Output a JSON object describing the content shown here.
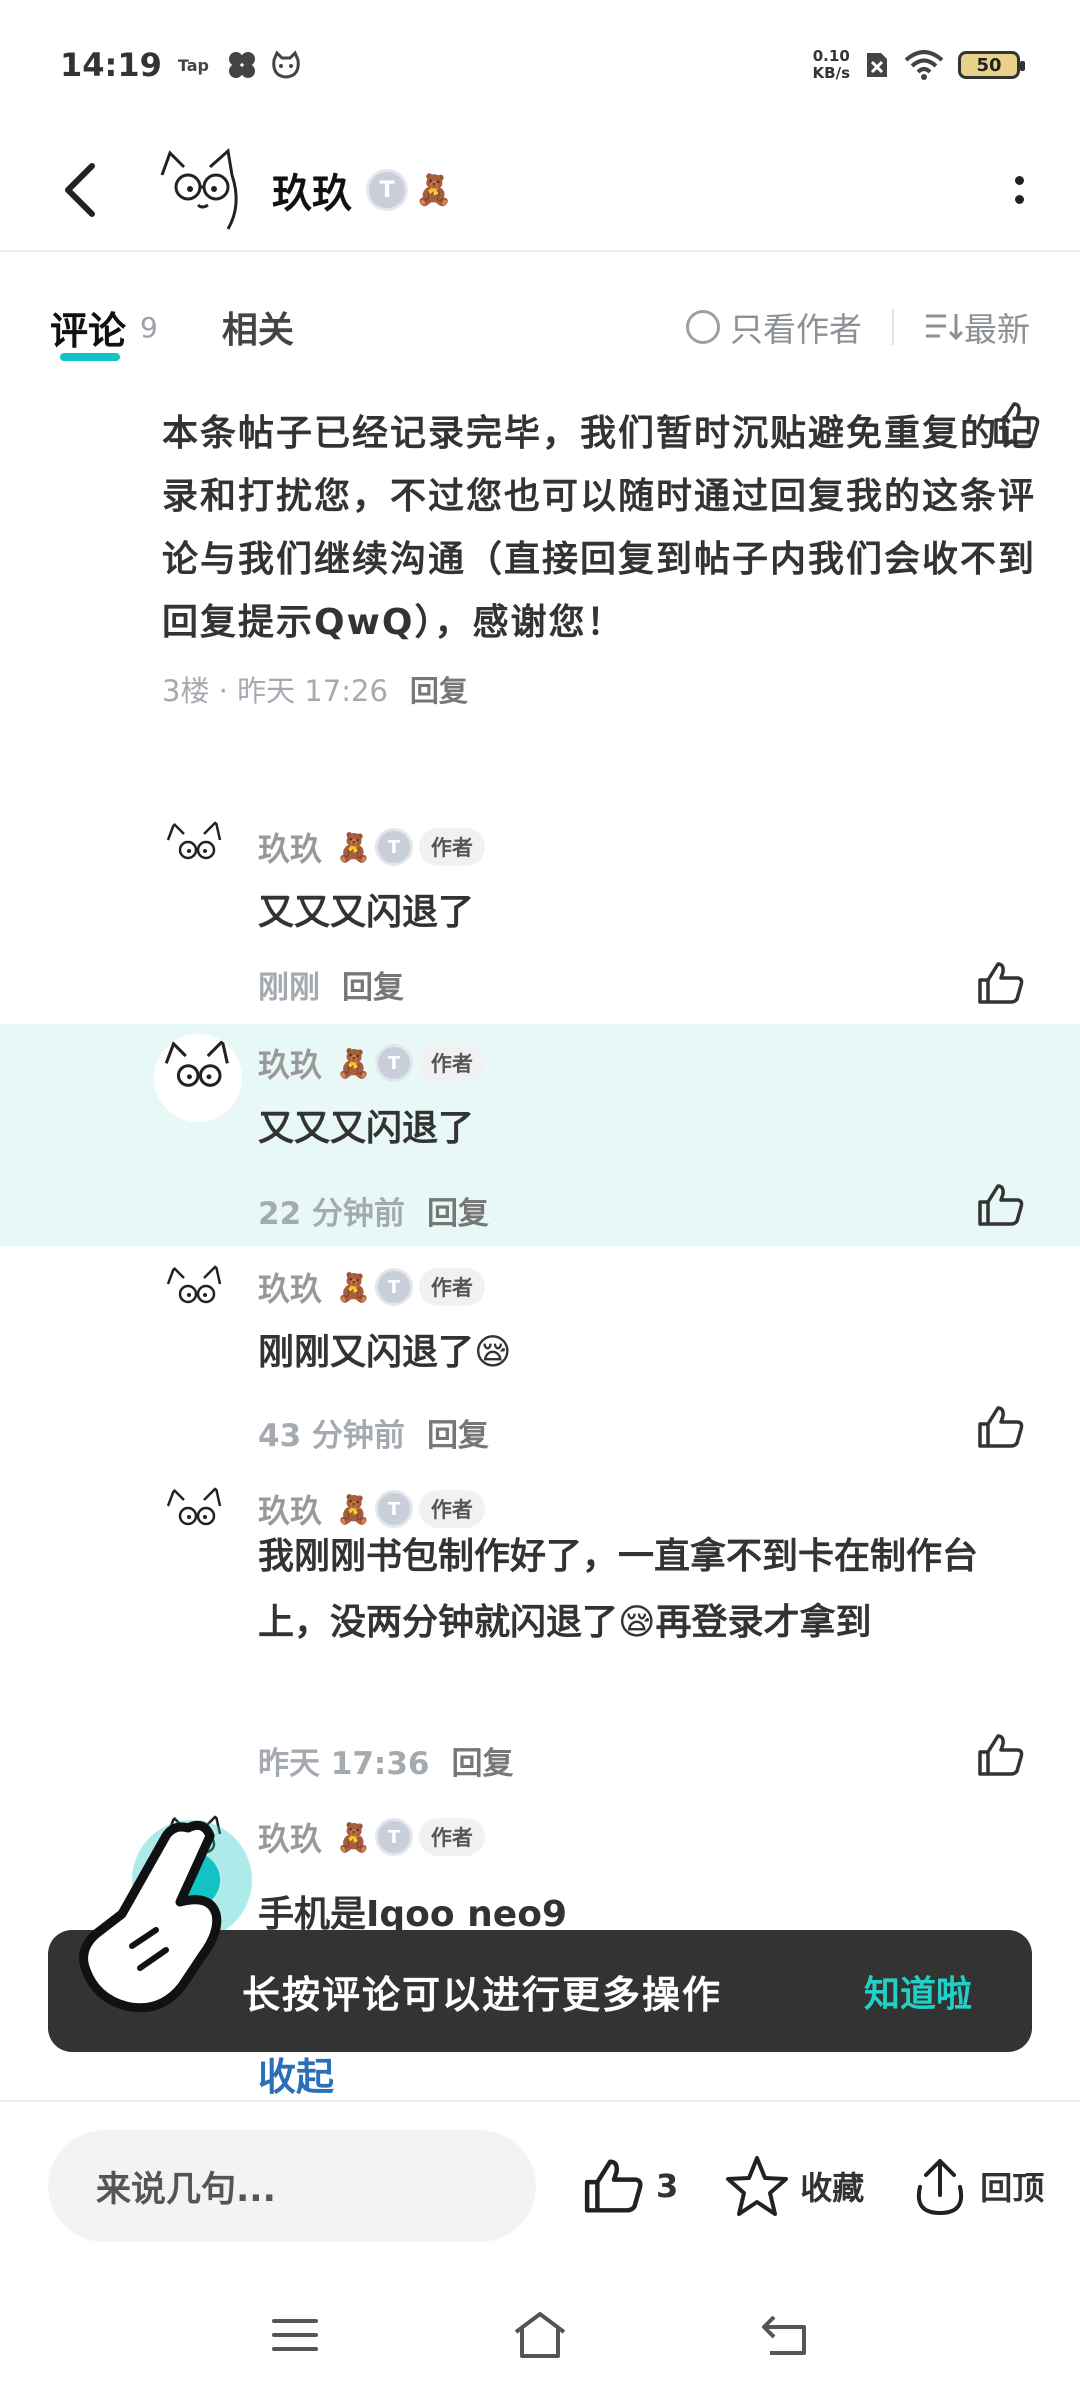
{
  "status_bar": {
    "time": "14:19",
    "app_tag": "Tap",
    "net_speed_value": "0.10",
    "net_speed_unit": "KB/s",
    "battery": "50"
  },
  "header": {
    "user_name": "玖玖",
    "badge_letter": "T"
  },
  "tabs": {
    "comments_label": "评论",
    "comments_count": "9",
    "related_label": "相关",
    "author_only_label": "只看作者",
    "sort_label": "最新"
  },
  "main_comment": {
    "text": "本条帖子已经记录完毕，我们暂时沉贴避免重复的记录和打扰您，不过您也可以随时通过回复我的这条评论与我们继续沟通（直接回复到帖子内我们会收不到回复提示QwQ），感谢您！",
    "meta": "3楼 · 昨天 17:26",
    "reply_label": "回复"
  },
  "replies": [
    {
      "name": "玖玖",
      "tag": "作者",
      "text": "又又又闪退了",
      "time": "刚刚",
      "reply_label": "回复"
    },
    {
      "name": "玖玖",
      "tag": "作者",
      "text": "又又又闪退了",
      "time": "22 分钟前",
      "reply_label": "回复"
    },
    {
      "name": "玖玖",
      "tag": "作者",
      "text": "刚刚又闪退了😪",
      "time": "43 分钟前",
      "reply_label": "回复"
    },
    {
      "name": "玖玖",
      "tag": "作者",
      "text": "我刚刚书包制作好了，一直拿不到卡在制作台上，没两分钟就闪退了😪再登录才拿到",
      "time": "昨天 17:36",
      "reply_label": "回复"
    },
    {
      "name": "玖玖",
      "tag": "作者",
      "text": "手机是Iqoo neo9"
    }
  ],
  "collapse_label": "收起",
  "toast": {
    "message": "长按评论可以进行更多操作",
    "button": "知道啦"
  },
  "bottom_bar": {
    "input_placeholder": "来说几句...",
    "like_count": "3",
    "favorite_label": "收藏",
    "top_label": "回顶"
  },
  "colors": {
    "accent": "#13c2c2",
    "highlight_bg": "#e8f8f7",
    "toast_bg": "#333333",
    "toast_button": "#1fd1c7",
    "collapse_link": "#2a6fb8"
  }
}
